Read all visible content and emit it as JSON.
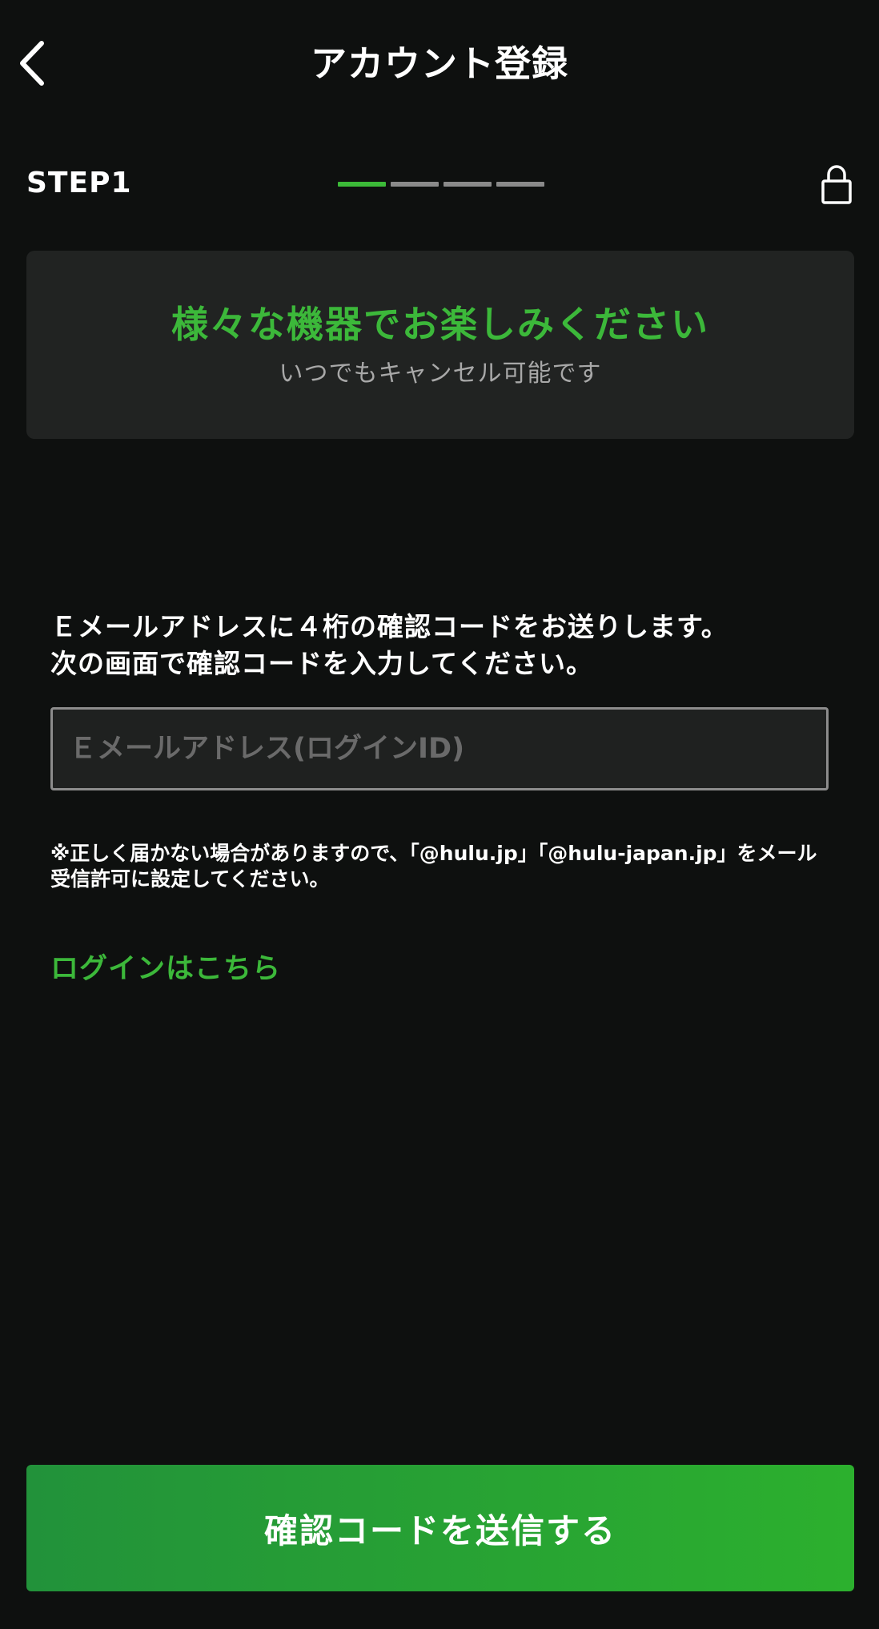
{
  "header": {
    "title": "アカウント登録",
    "back_icon": "chevron-left-icon"
  },
  "step": {
    "label": "STEP1",
    "progress": {
      "current": 1,
      "total": 4
    },
    "lock_icon": "lock-icon"
  },
  "banner": {
    "title": "様々な機器でお楽しみください",
    "subtitle": "いつでもキャンセル可能です"
  },
  "form": {
    "instruction_line1": "Ｅメールアドレスに４桁の確認コードをお送りします。",
    "instruction_line2": "次の画面で確認コードを入力してください。",
    "email_value": "",
    "email_placeholder": "Ｅメールアドレス(ログインID)",
    "note": "※正しく届かない場合がありますので、「@hulu.jp」「@hulu-japan.jp」をメール受信許可に設定してください。",
    "login_link": "ログインはこちら",
    "submit_label": "確認コードを送信する"
  },
  "colors": {
    "background": "#0e100f",
    "accent": "#3cb83a",
    "banner_bg": "#212322",
    "inactive_segment": "#8a8a8a"
  }
}
